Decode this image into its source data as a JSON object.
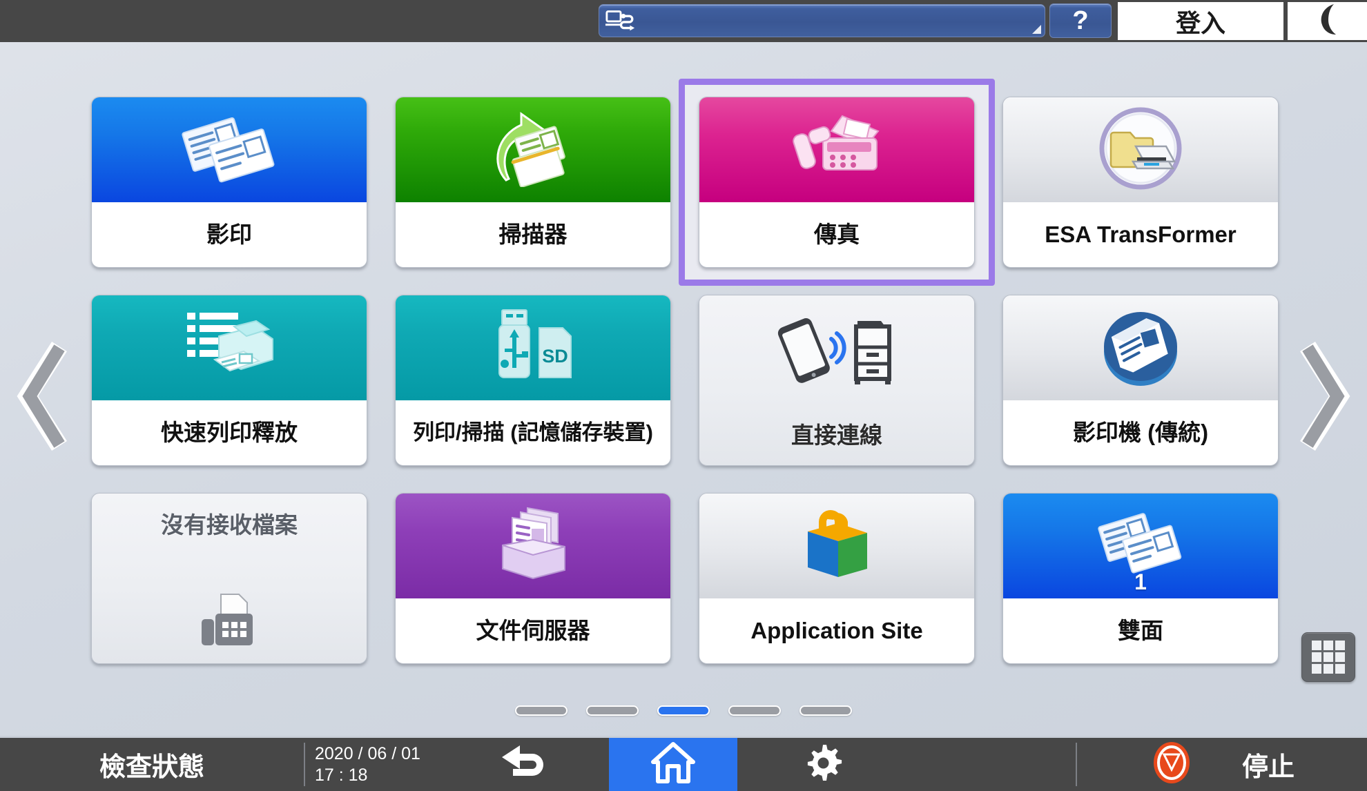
{
  "topbar": {
    "address_field_placeholder": "",
    "address_field_value": "",
    "address_icon": "device-transfer-icon",
    "help_label": "?",
    "login_label": "登入",
    "sleep_icon": "moon-icon"
  },
  "tiles": [
    {
      "label": "影印",
      "icon": "copy-icon",
      "style": "hd-blue",
      "selected": false
    },
    {
      "label": "掃描器",
      "icon": "scanner-icon",
      "style": "hd-green",
      "selected": false
    },
    {
      "label": "傳真",
      "icon": "fax-machine-icon",
      "style": "hd-pink",
      "selected": true
    },
    {
      "label": "ESA TransFormer",
      "icon": "folder-scanner-icon",
      "style": "hd-gray",
      "selected": false
    },
    {
      "label": "快速列印釋放",
      "icon": "print-release-icon",
      "style": "hd-teal",
      "selected": false
    },
    {
      "label": "列印/掃描 (記憶儲存裝置)",
      "icon": "usb-sd-icon",
      "style": "hd-teal",
      "selected": false
    },
    {
      "label": "直接連線",
      "icon": "mobile-printer-icon",
      "style": "plain",
      "selected": false
    },
    {
      "label": "影印機 (傳統)",
      "icon": "classic-copier-icon",
      "style": "hd-gray",
      "selected": false
    },
    {
      "label": "沒有接收檔案",
      "icon": "fax-gray-icon",
      "style": "noreceive",
      "selected": false
    },
    {
      "label": "文件伺服器",
      "icon": "document-server-icon",
      "style": "hd-purple",
      "selected": false
    },
    {
      "label": "Application Site",
      "icon": "app-bag-icon",
      "style": "hd-gray",
      "selected": false
    },
    {
      "label": "雙面",
      "icon": "duplex-icon",
      "style": "hd-blue",
      "selected": false,
      "badge": "1"
    }
  ],
  "nav": {
    "prev_icon": "chevron-left-icon",
    "next_icon": "chevron-right-icon",
    "page_count": 5,
    "active_page": 3,
    "grid_toggle_icon": "grid-view-icon"
  },
  "bottombar": {
    "check_status_label": "檢查狀態",
    "date": "2020 / 06 / 01",
    "time": "17 : 18",
    "back_icon": "back-arrow-icon",
    "home_icon": "home-icon",
    "settings_icon": "gear-icon",
    "stop_icon": "stop-icon",
    "stop_label": "停止"
  },
  "colors": {
    "accent_blue": "#2a74ef",
    "selection_purple": "#9b7ae8",
    "topbar_dark": "#474747",
    "stop_orange": "#e8491c",
    "page_bg": "#d7dce4"
  }
}
